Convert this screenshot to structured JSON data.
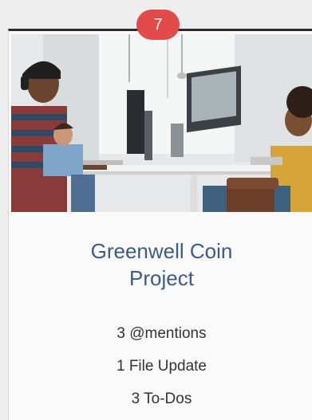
{
  "notification_count": "7",
  "card": {
    "title": "Greenwell Coin Project",
    "stats": [
      "3 @mentions",
      "1 File Update",
      "3 To-Dos"
    ]
  },
  "colors": {
    "badge": "#e34b4b",
    "title": "#3d5b86",
    "top_border": "#2b2b2b"
  }
}
